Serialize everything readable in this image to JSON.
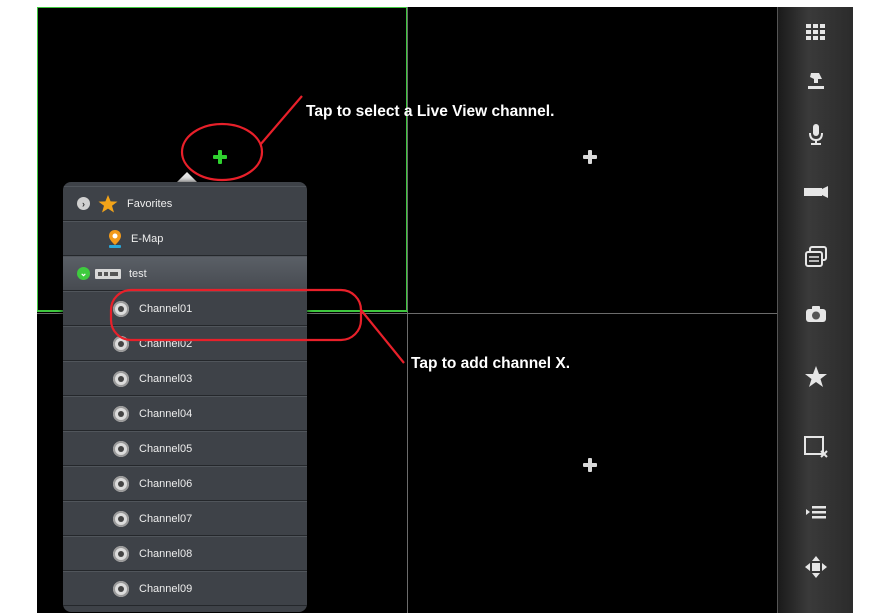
{
  "annotations": {
    "select_channel": "Tap to select a Live View channel.",
    "add_channel": "Tap to add channel X."
  },
  "colors": {
    "annotation_red": "#e8202a",
    "active_border": "#3ec63e",
    "plus_active": "#2fd12f"
  },
  "popup": {
    "favorites": "Favorites",
    "emap": "E-Map",
    "group": "test",
    "channels": [
      "Channel01",
      "Channel02",
      "Channel03",
      "Channel04",
      "Channel05",
      "Channel06",
      "Channel07",
      "Channel08",
      "Channel09"
    ]
  },
  "toolbar": {
    "icons": [
      "layout-grid-icon",
      "ptz-icon",
      "microphone-icon",
      "record-icon",
      "switch-stream-icon",
      "snapshot-icon",
      "favorite-star-icon",
      "close-view-icon",
      "list-menu-icon",
      "direction-pad-icon"
    ]
  }
}
